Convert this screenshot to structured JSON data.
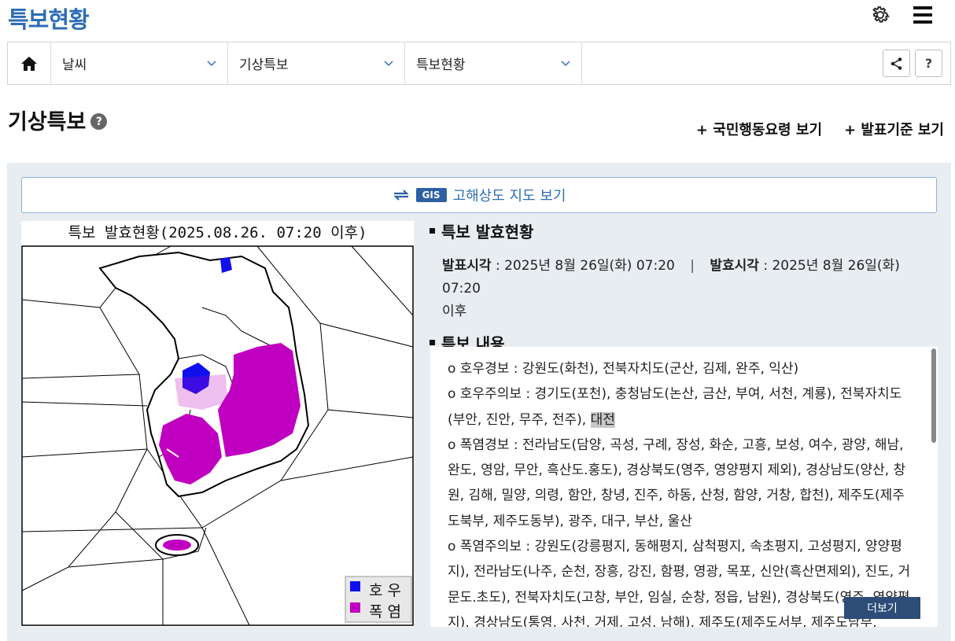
{
  "header": {
    "title": "특보현황"
  },
  "nav": {
    "items": [
      {
        "label": "날씨"
      },
      {
        "label": "기상특보"
      },
      {
        "label": "특보현황"
      }
    ],
    "help_label": "?"
  },
  "section": {
    "title": "기상특보",
    "help_label": "?",
    "link_action_guide": "+ 국민행동요령 보기",
    "link_criteria": "+ 발표기준 보기"
  },
  "gis": {
    "badge": "GIS",
    "label": "고해상도 지도 보기"
  },
  "map": {
    "caption": "특보 발효현황(2025.08.26. 07:20 이후)",
    "legend": [
      {
        "label": "호우",
        "color": "#1010ee"
      },
      {
        "label": "폭염",
        "color": "#c000c0"
      }
    ]
  },
  "info": {
    "status_heading": "특보 발효현황",
    "announce_label": "발표시각",
    "announce_value": " : 2025년 8월 26일(화) 07:20",
    "separator": "|",
    "effective_label": "발효시각",
    "effective_value": " : 2025년 8월 26일(화) 07:20",
    "effective_suffix": "이후",
    "content_heading": "특보 내용"
  },
  "content": {
    "lines": [
      "o 호우경보 : 강원도(화천), 전북자치도(군산, 김제, 완주, 익산)",
      "o 호우주의보 : 경기도(포천), 충청남도(논산, 금산, 부여, 서천, 계룡), 전북자치도(부안, 진안, 무주, 전주), ",
      "o 폭염경보 : 전라남도(담양, 곡성, 구례, 장성, 화순, 고흥, 보성, 여수, 광양, 해남, 완도, 영암, 무안, 흑산도.홍도), 경상북도(영주, 영양평지 제외), 경상남도(양산, 창원, 김해, 밀양, 의령, 함안, 창녕, 진주, 하동, 산청, 함양, 거창, 합천), 제주도(제주도북부, 제주도동부), 광주, 대구, 부산, 울산",
      "o 폭염주의보 : 강원도(강릉평지, 동해평지, 삼척평지, 속초평지, 고성평지, 양양평지), 전라남도(나주, 순천, 장흥, 강진, 함평, 영광, 목포, 신안(흑산면제외), 진도, 거문도.초도), 전북자치도(고창, 부안, 임실, 순창, 정읍, 남원), 경상북도(영주, 영양평지), 경상남도(통영, 사천, 거제, 고성, 남해), 제주도(제주도서부, 제주도남부,"
    ],
    "highlight": "대전",
    "more_label": "더보기"
  },
  "colors": {
    "accent": "#2d6db5",
    "panel_bg": "#e8edf2",
    "rain": "#1010ee",
    "heat": "#c000c0"
  }
}
